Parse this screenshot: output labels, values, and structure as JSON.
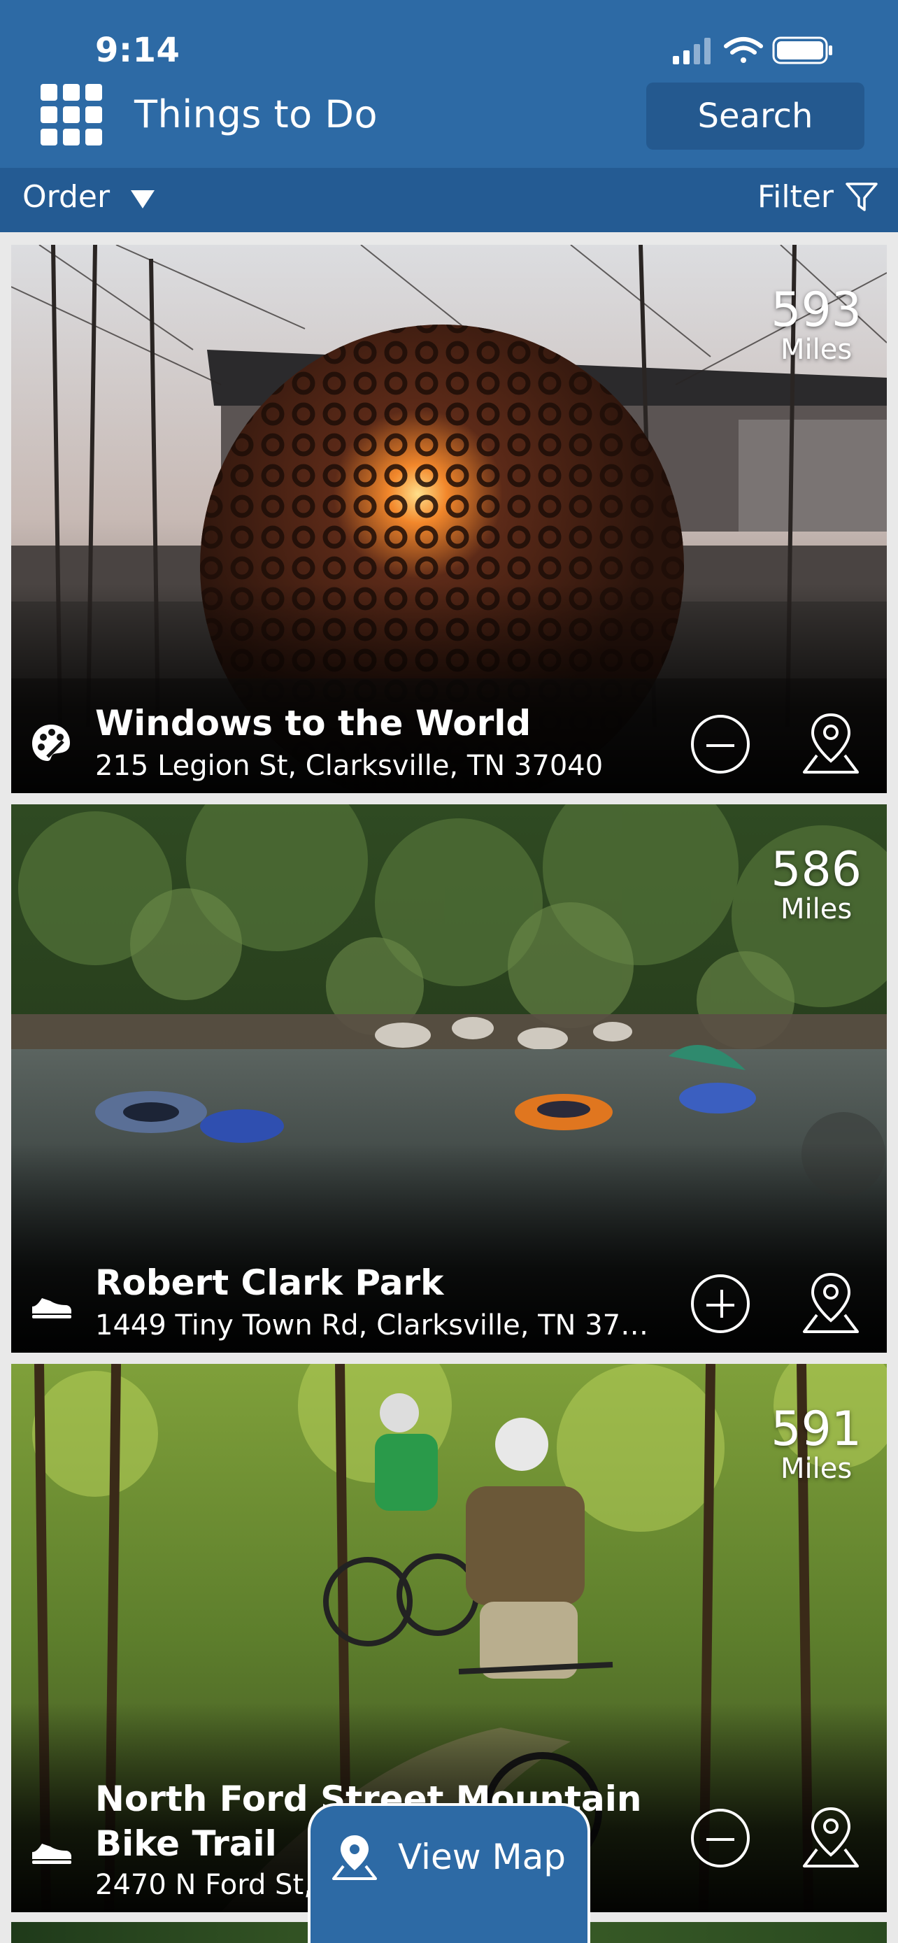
{
  "status_bar": {
    "time": "9:14"
  },
  "header": {
    "title": "Things to Do",
    "search_label": "Search"
  },
  "subbar": {
    "order_label": "Order",
    "filter_label": "Filter"
  },
  "cards": [
    {
      "distance": "593",
      "unit": "Miles",
      "name": "Windows to the World",
      "address": "215 Legion St, Clarksville, TN 37040",
      "category_icon": "palette-icon",
      "action": "remove"
    },
    {
      "distance": "586",
      "unit": "Miles",
      "name": "Robert Clark Park",
      "address": "1449 Tiny Town Rd, Clarksville, TN 370...",
      "category_icon": "sneaker-icon",
      "action": "add"
    },
    {
      "distance": "591",
      "unit": "Miles",
      "name": "North Ford Street Mountain Bike Trail",
      "address": "2470 N Ford St,",
      "category_icon": "sneaker-icon",
      "action": "remove"
    }
  ],
  "view_map": {
    "label": "View Map"
  },
  "colors": {
    "header": "#2d6aa5",
    "subbar": "#245b93",
    "search_btn": "#24598f"
  }
}
